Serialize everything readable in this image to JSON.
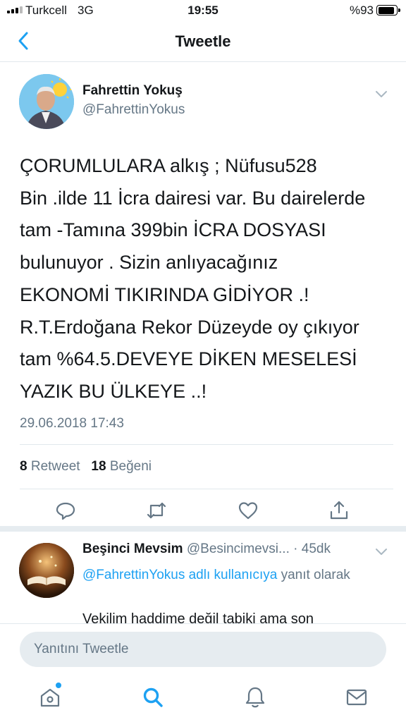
{
  "status_bar": {
    "carrier": "Turkcell",
    "network": "3G",
    "time": "19:55",
    "battery": "%93",
    "battery_level": 0.93
  },
  "nav": {
    "title": "Tweetle",
    "back_icon": "chevron-left-icon"
  },
  "tweet": {
    "author_name": "Fahrettin Yokuş",
    "author_handle": "@FahrettinYokus",
    "text_lines": [
      "ÇORUMLULARA alkış ; Nüfusu528",
      "Bin .ilde 11 İcra  dairesi var. Bu dairelerde",
      "tam -Tamına 399bin İCRA DOSYASI",
      "bulunuyor . Sizin anlıyacağınız",
      "EKONOMİ TIKIRINDA GİDİYOR .!",
      "R.T.Erdoğana Rekor Düzeyde oy çıkıyor",
      "tam %64.5.DEVEYE DİKEN MESELESİ",
      "YAZIK BU ÜLKEYE ..!"
    ],
    "timestamp": "29.06.2018 17:43",
    "retweet_count": "8",
    "retweet_label": "Retweet",
    "like_count": "18",
    "like_label": "Beğeni",
    "actions": [
      "reply-icon",
      "retweet-icon",
      "heart-icon",
      "share-icon"
    ]
  },
  "reply": {
    "author_name": "Beşinci Mevsim",
    "author_handle": "@Besincimevsi...",
    "time": "· 45dk",
    "reply_to_mention": "@FahrettinYokus adlı kullanıcıya",
    "reply_to_suffix": " yanıt olarak",
    "text": "Vekilim haddime değil tabiki ama son"
  },
  "compose": {
    "placeholder": "Yanıtını Tweetle"
  },
  "tabbar": {
    "items": [
      "home-icon",
      "search-icon",
      "notifications-icon",
      "messages-icon"
    ]
  },
  "colors": {
    "accent": "#1da1f2",
    "secondary_text": "#657786",
    "divider": "#e1e8ed"
  }
}
